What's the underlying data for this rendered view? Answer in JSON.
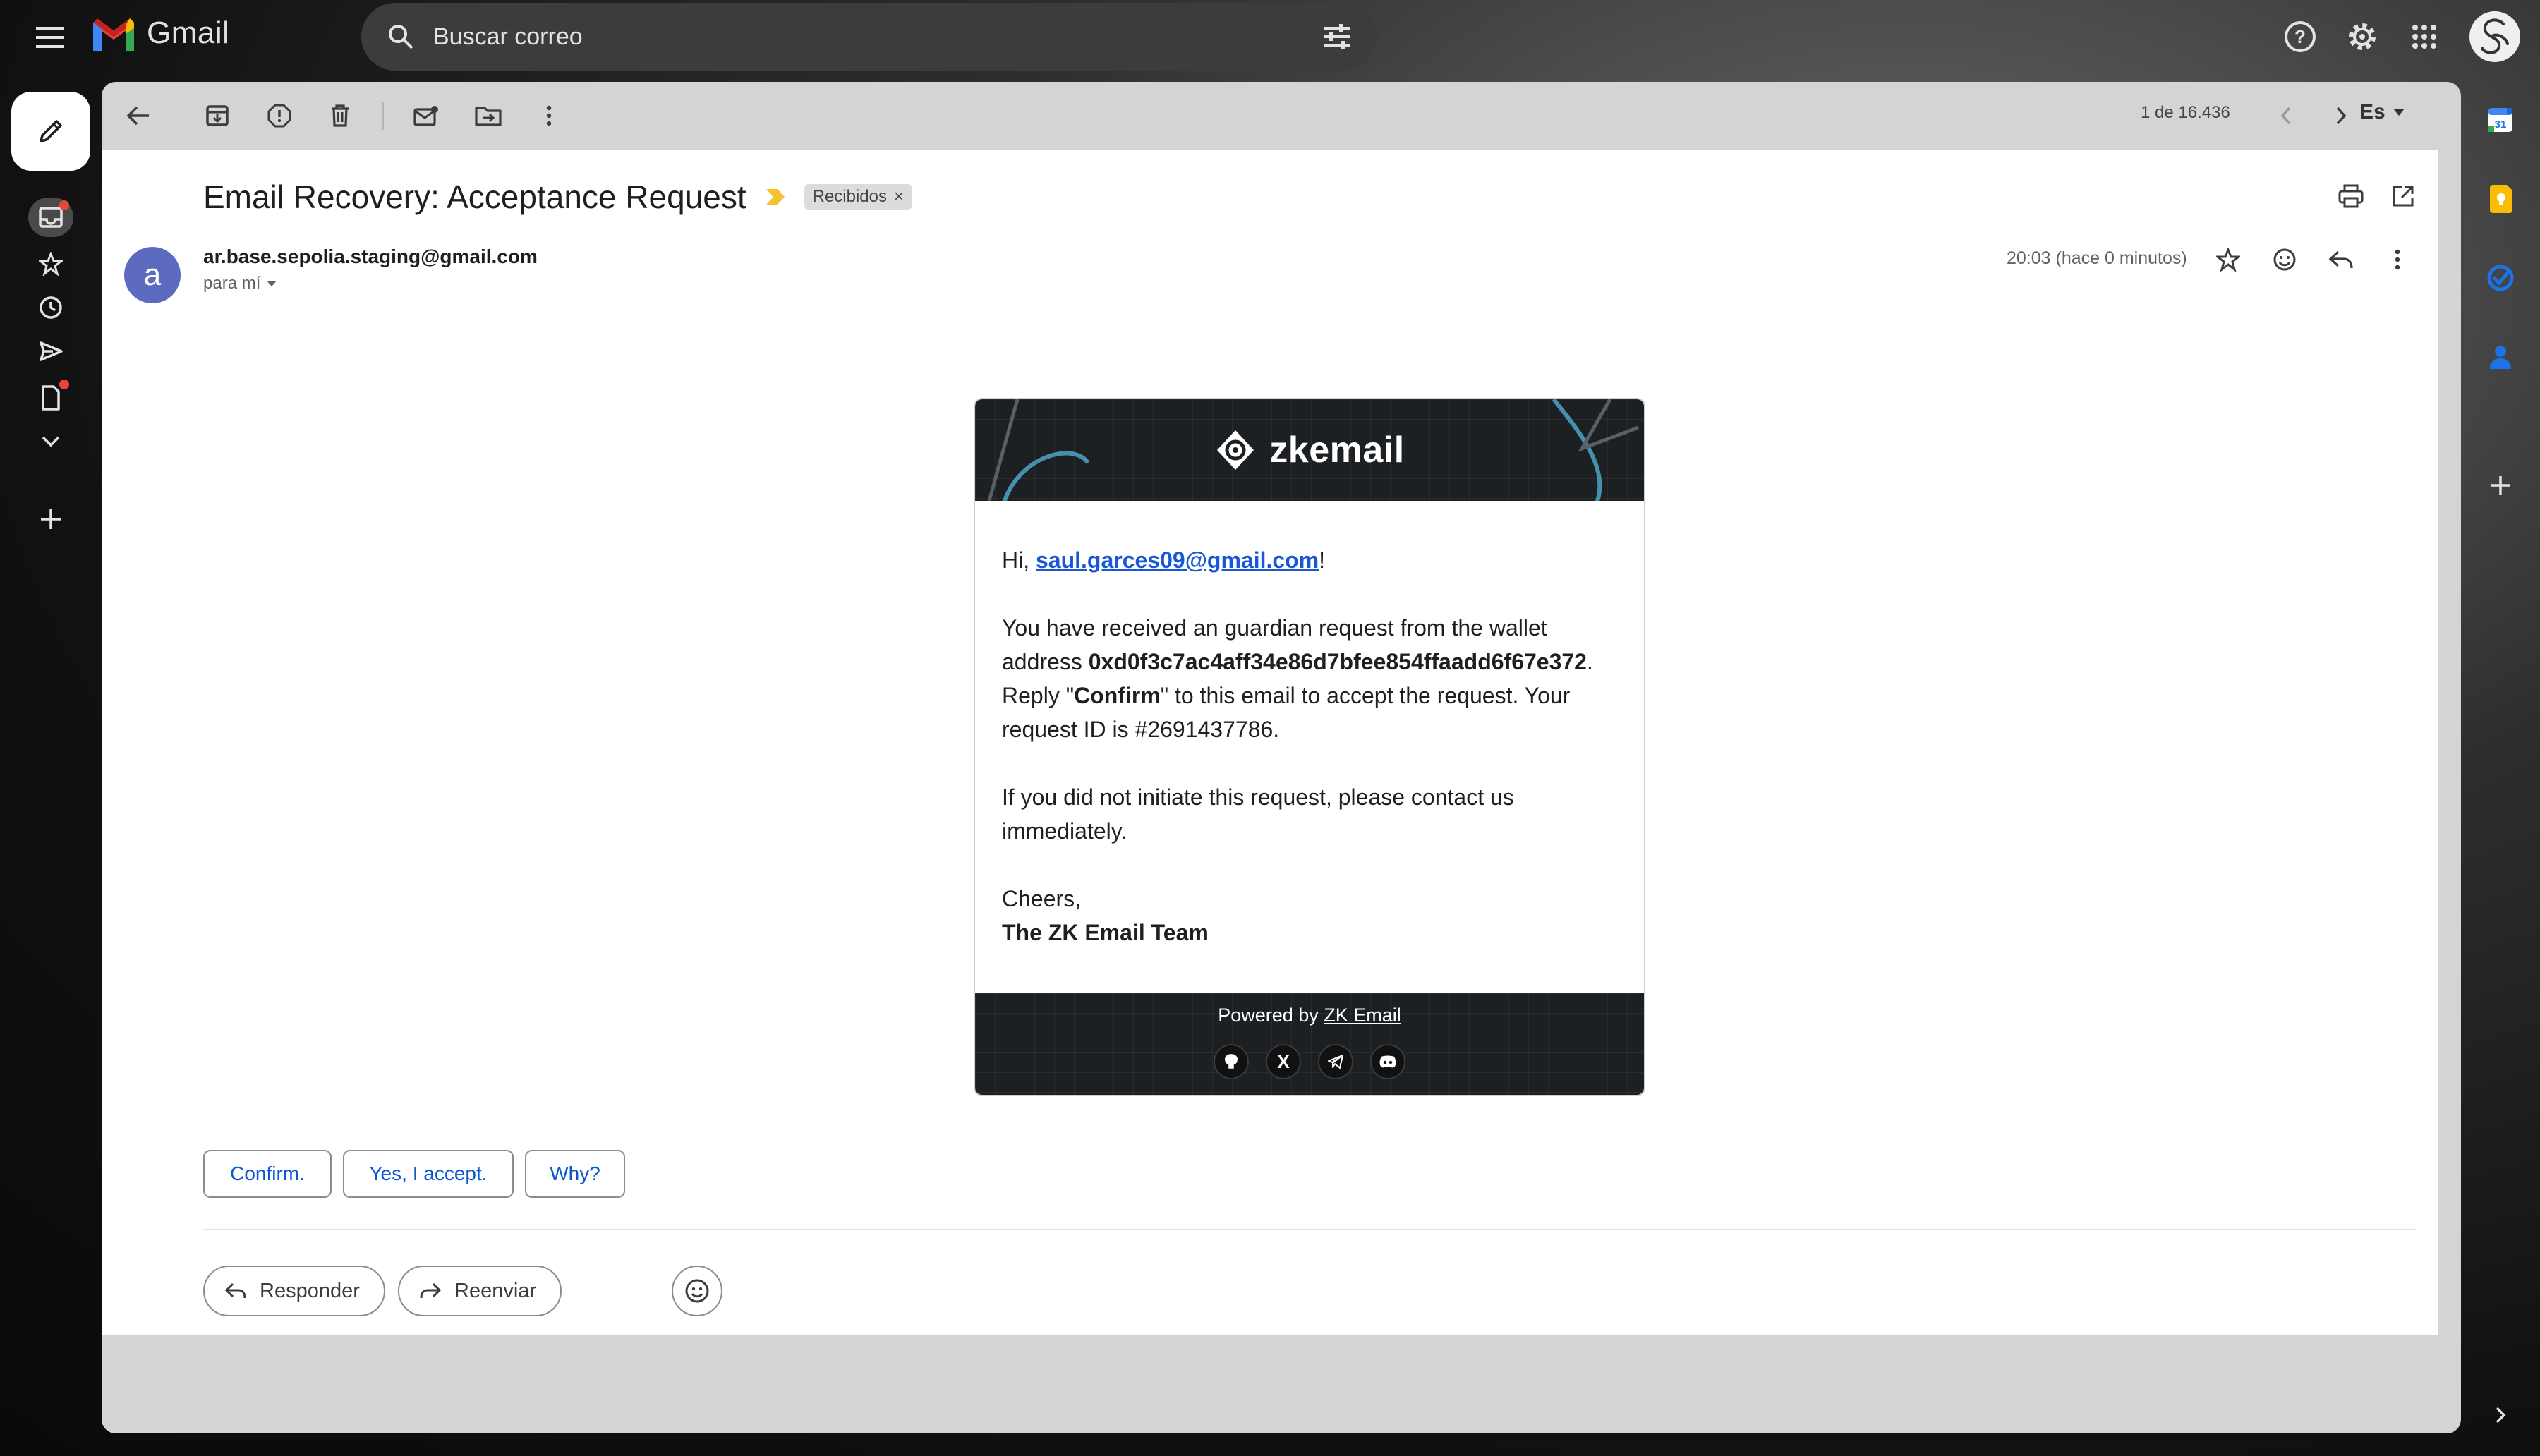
{
  "app": {
    "name": "Gmail",
    "search_placeholder": "Buscar correo"
  },
  "toolbar": {
    "pager": "1 de 16.436",
    "language": "Es"
  },
  "email": {
    "subject": "Email Recovery: Acceptance Request",
    "label": "Recibidos",
    "label_close": "×",
    "sender_initial": "a",
    "sender_email": "ar.base.sepolia.staging@gmail.com",
    "recipient": "para mí",
    "timestamp": "20:03 (hace 0 minutos)"
  },
  "card": {
    "brand": "zkemail",
    "greeting_prefix": "Hi, ",
    "greeting_email": "saul.garces09@gmail.com",
    "greeting_suffix": "!",
    "p1_a": "You have received an guardian request from the wallet address ",
    "p1_wallet": "0xd0f3c7ac4aff34e86d7bfee854ffaadd6f67e372",
    "p1_b": ". Reply \"",
    "p1_confirm": "Confirm",
    "p1_c": "\" to this email to accept the request. Your request ID is #2691437786.",
    "p2": "If you did not initiate this request, please contact us immediately.",
    "cheers": "Cheers,",
    "team": "The ZK Email Team",
    "powered_by": "Powered by ",
    "powered_link": "ZK Email",
    "social_x": "X"
  },
  "smart_replies": [
    "Confirm.",
    "Yes, I accept.",
    "Why?"
  ],
  "actions": {
    "reply": "Responder",
    "forward": "Reenviar"
  },
  "colors": {
    "accent_blue": "#0b57d0",
    "sender_avatar": "#5c6bc0",
    "important_marker": "#f4c430"
  }
}
